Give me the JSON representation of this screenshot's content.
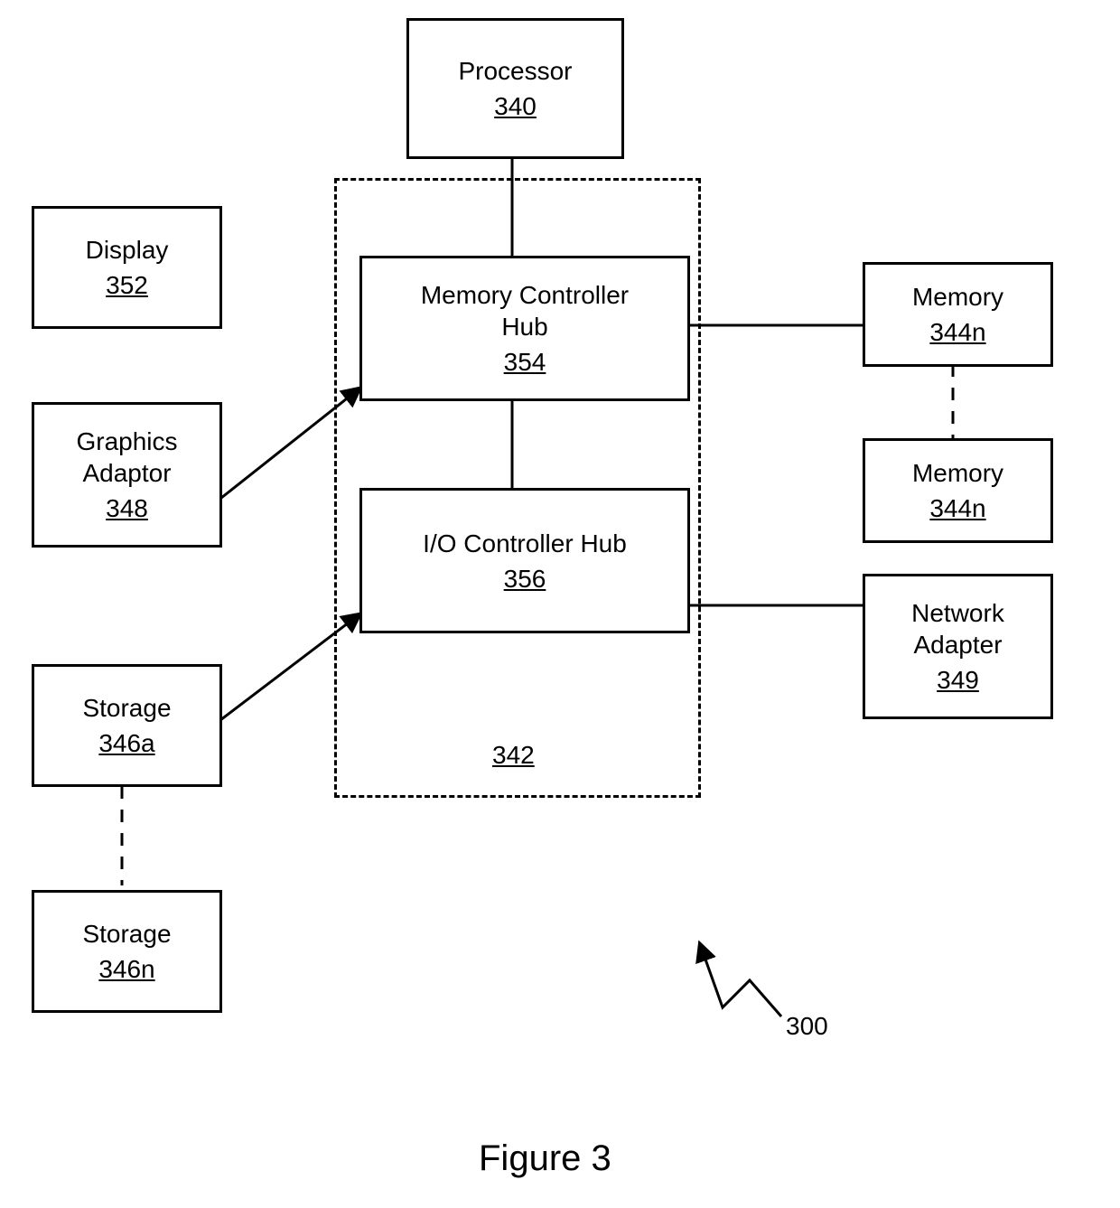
{
  "figure": {
    "caption": "Figure 3",
    "system_ref": "300",
    "chipset_ref": "342"
  },
  "blocks": {
    "processor": {
      "label": "Processor",
      "ref": "340"
    },
    "mch": {
      "label": "Memory Controller\nHub",
      "ref": "354"
    },
    "ich": {
      "label": "I/O Controller Hub",
      "ref": "356"
    },
    "display": {
      "label": "Display",
      "ref": "352"
    },
    "graphics": {
      "label": "Graphics\nAdaptor",
      "ref": "348"
    },
    "storage_a": {
      "label": "Storage",
      "ref": "346a"
    },
    "storage_n": {
      "label": "Storage",
      "ref": "346n"
    },
    "mem_top": {
      "label": "Memory",
      "ref": "344n"
    },
    "mem_bot": {
      "label": "Memory",
      "ref": "344n"
    },
    "net": {
      "label": "Network\nAdapter",
      "ref": "349"
    }
  }
}
